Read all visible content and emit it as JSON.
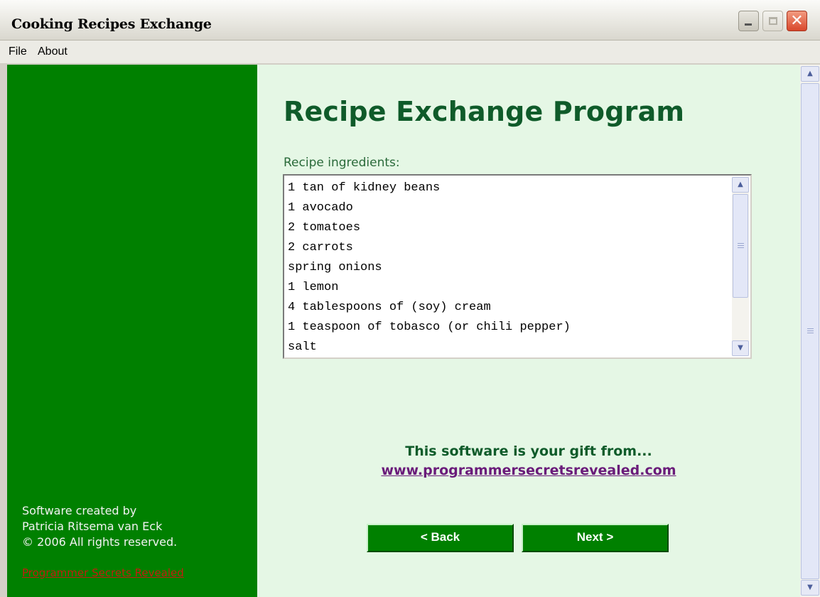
{
  "window": {
    "title": "Cooking Recipes Exchange",
    "close_glyph": "✕"
  },
  "menu": {
    "file": "File",
    "about": "About"
  },
  "sidebar": {
    "credit_line1": "Software created by",
    "credit_line2": "Patricia Ritsema van Eck",
    "credit_line3": "© 2006 All rights reserved.",
    "link": "Programmer Secrets Revealed",
    "link_color": "#c21d0f",
    "background": "#008000"
  },
  "main": {
    "heading": "Recipe Exchange Program",
    "ingredients_label": "Recipe ingredients:",
    "ingredients": [
      "1 tan of kidney beans",
      "1 avocado",
      "2 tomatoes",
      "2 carrots",
      "spring onions",
      "1 lemon",
      "4 tablespoons of (soy) cream",
      "1 teaspoon of tobasco (or chili pepper)",
      "salt"
    ],
    "gift_text": "This software is your gift from...",
    "gift_url": "www.programmersecretsrevealed.com",
    "back_label": "< Back",
    "next_label": "Next >",
    "background": "#e5f7e5",
    "heading_color": "#0f5b2a"
  },
  "icons": {
    "up": "chevron-up-icon",
    "down": "chevron-down-icon"
  }
}
